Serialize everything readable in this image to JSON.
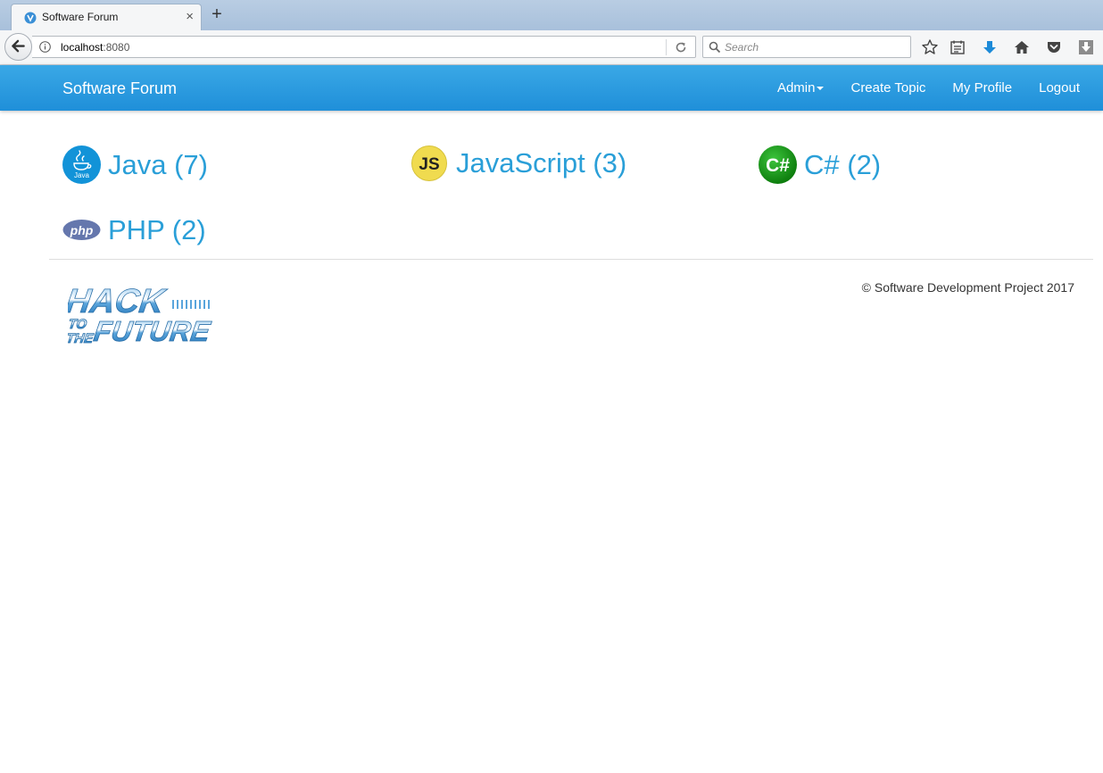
{
  "browser": {
    "tab_title": "Software Forum",
    "new_tab_glyph": "+",
    "close_glyph": "×",
    "url_host": "localhost",
    "url_port": ":8080",
    "search_placeholder": "Search"
  },
  "nav": {
    "brand": "Software Forum",
    "admin": "Admin",
    "create_topic": "Create Topic",
    "my_profile": "My Profile",
    "logout": "Logout"
  },
  "categories": [
    {
      "label": "Java (7)",
      "icon": "java-icon",
      "color": "#1293d8"
    },
    {
      "label": "JavaScript (3)",
      "icon": "javascript-icon",
      "color": "#f0db4f"
    },
    {
      "label": "C# (2)",
      "icon": "csharp-icon",
      "color": "#1a9b1a"
    },
    {
      "label": "PHP (2)",
      "icon": "php-icon",
      "color": "#6577ad"
    }
  ],
  "footer": {
    "copyright": "© Software Development Project 2017",
    "logo_text": [
      "HACK",
      "TO",
      "THE",
      "FUTURE"
    ]
  },
  "colors": {
    "accent": "#2a9fd8",
    "navbar": "#2a9ce0"
  }
}
